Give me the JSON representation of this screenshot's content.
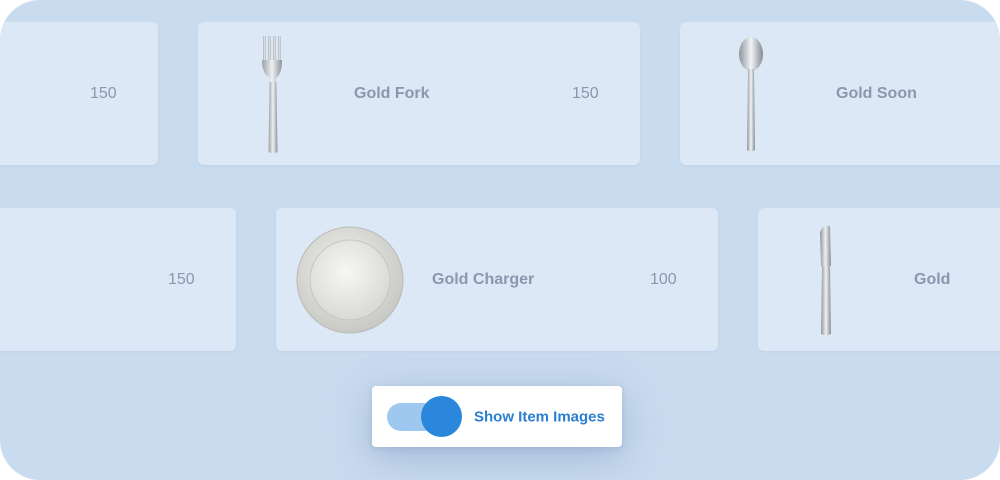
{
  "cards": [
    {
      "name": "",
      "quantity": "150",
      "image": "none"
    },
    {
      "name": "Gold Fork",
      "quantity": "150",
      "image": "fork-icon"
    },
    {
      "name": "Gold Soon",
      "quantity": "",
      "image": "spoon-icon"
    },
    {
      "name": "",
      "quantity": "150",
      "image": "none"
    },
    {
      "name": "Gold Charger",
      "quantity": "100",
      "image": "charger-plate-icon"
    },
    {
      "name": "Gold",
      "quantity": "",
      "image": "butter-knife-icon"
    }
  ],
  "toggle": {
    "label": "Show Item Images",
    "checked": true
  },
  "colors": {
    "background": "#c9dbef",
    "card": "#dde8f7",
    "card_text": "#8a98ad",
    "accent": "#2a87dc",
    "track": "#9ec8f0"
  }
}
